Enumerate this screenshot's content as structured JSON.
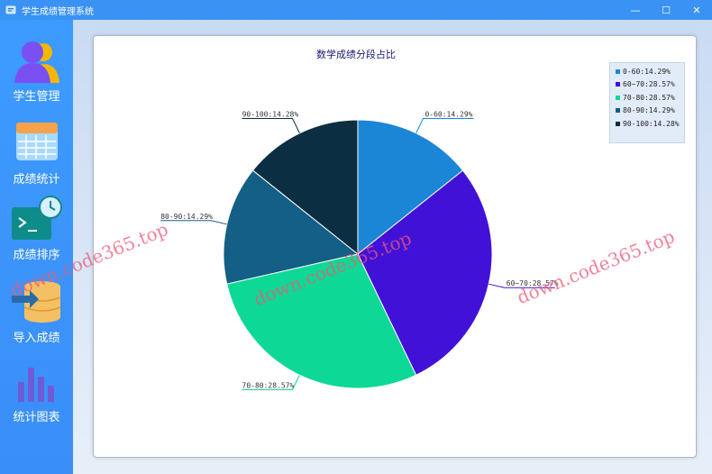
{
  "window": {
    "title": "学生成绩管理系统",
    "controls": [
      "—",
      "☐",
      "✕"
    ]
  },
  "sidebar": {
    "items": [
      {
        "label": "学生管理",
        "icon": "users-icon"
      },
      {
        "label": "成绩统计",
        "icon": "calendar-grid-icon"
      },
      {
        "label": "成绩排序",
        "icon": "terminal-clock-icon"
      },
      {
        "label": "导入成绩",
        "icon": "database-import-icon"
      },
      {
        "label": "统计图表",
        "icon": "bar-chart-icon"
      }
    ]
  },
  "chart_data": {
    "type": "pie",
    "title": "数学成绩分段占比",
    "slices": [
      {
        "category": "0-60",
        "percent": 14.29,
        "label": "0-60:14.29%",
        "color": "#1b86d6"
      },
      {
        "category": "60~70",
        "percent": 28.57,
        "label": "60~70:28.57%",
        "color": "#4211d8"
      },
      {
        "category": "70-80",
        "percent": 28.57,
        "label": "70-80:28.57%",
        "color": "#0ed895"
      },
      {
        "category": "80-90",
        "percent": 14.29,
        "label": "80-90:14.29%",
        "color": "#135f85"
      },
      {
        "category": "90-100",
        "percent": 14.28,
        "label": "90-100:14.28%",
        "color": "#0c2e42"
      }
    ],
    "legend_position": "top-right"
  },
  "watermark": "down.code365.top",
  "colors": {
    "titlebar": "#3a93f4",
    "sidebar": "#3d9bff",
    "chart_title": "#1a1a6e"
  }
}
